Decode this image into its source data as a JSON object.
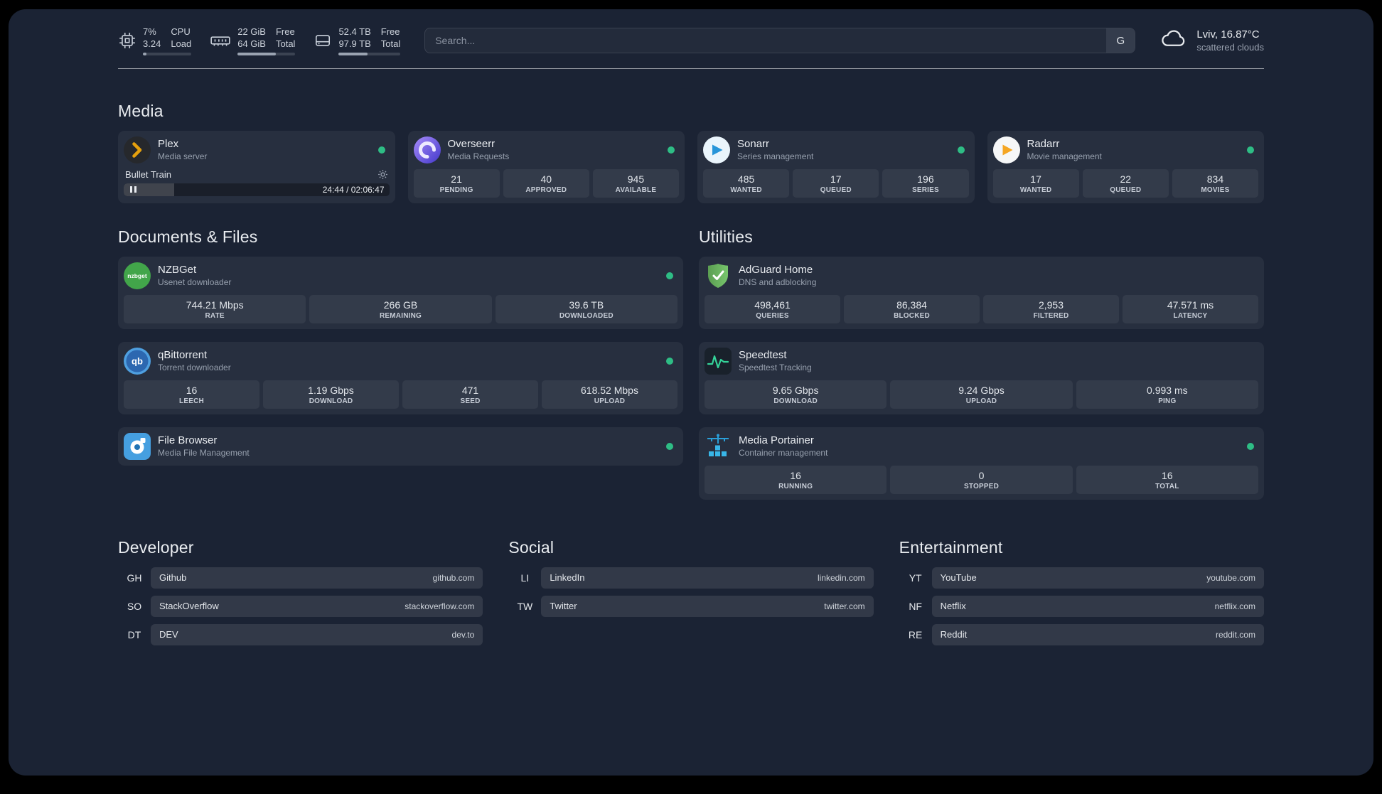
{
  "colors": {
    "panel_bg": "#1b2334",
    "status_online": "#2ebd85",
    "plex_accent": "#e5a00d",
    "progress_fill": "#9aa3b1"
  },
  "topbar": {
    "cpu": {
      "value": "7%",
      "sub": "3.24",
      "label": "CPU",
      "sublabel": "Load",
      "bar": "width:7%"
    },
    "memory": {
      "value": "22 GiB",
      "sub": "64 GiB",
      "label": "Free",
      "sublabel": "Total",
      "bar": "width:66%"
    },
    "disk": {
      "value": "52.4 TB",
      "sub": "97.9 TB",
      "label": "Free",
      "sublabel": "Total",
      "bar": "width:47%"
    },
    "search": {
      "placeholder": "Search...",
      "provider": "G"
    },
    "weather": {
      "location": "Lviv, 16.87°C",
      "condition": "scattered clouds"
    }
  },
  "media": {
    "title": "Media",
    "plex": {
      "name": "Plex",
      "desc": "Media server",
      "np_title": "Bullet Train",
      "np_time": "24:44 / 02:06:47",
      "np_bar": "width:19%"
    },
    "overseerr": {
      "name": "Overseerr",
      "desc": "Media Requests",
      "stats": [
        {
          "v": "21",
          "l": "PENDING"
        },
        {
          "v": "40",
          "l": "APPROVED"
        },
        {
          "v": "945",
          "l": "AVAILABLE"
        }
      ]
    },
    "sonarr": {
      "name": "Sonarr",
      "desc": "Series management",
      "stats": [
        {
          "v": "485",
          "l": "WANTED"
        },
        {
          "v": "17",
          "l": "QUEUED"
        },
        {
          "v": "196",
          "l": "SERIES"
        }
      ]
    },
    "radarr": {
      "name": "Radarr",
      "desc": "Movie management",
      "stats": [
        {
          "v": "17",
          "l": "WANTED"
        },
        {
          "v": "22",
          "l": "QUEUED"
        },
        {
          "v": "834",
          "l": "MOVIES"
        }
      ]
    }
  },
  "documents": {
    "title": "Documents & Files",
    "nzbget": {
      "name": "NZBGet",
      "desc": "Usenet downloader",
      "stats": [
        {
          "v": "744.21 Mbps",
          "l": "RATE"
        },
        {
          "v": "266 GB",
          "l": "REMAINING"
        },
        {
          "v": "39.6 TB",
          "l": "DOWNLOADED"
        }
      ]
    },
    "qbittorrent": {
      "name": "qBittorrent",
      "desc": "Torrent downloader",
      "stats": [
        {
          "v": "16",
          "l": "LEECH"
        },
        {
          "v": "1.19 Gbps",
          "l": "DOWNLOAD"
        },
        {
          "v": "471",
          "l": "SEED"
        },
        {
          "v": "618.52 Mbps",
          "l": "UPLOAD"
        }
      ]
    },
    "filebrowser": {
      "name": "File Browser",
      "desc": "Media File Management"
    }
  },
  "utilities": {
    "title": "Utilities",
    "adguard": {
      "name": "AdGuard Home",
      "desc": "DNS and adblocking",
      "stats": [
        {
          "v": "498,461",
          "l": "QUERIES"
        },
        {
          "v": "86,384",
          "l": "BLOCKED"
        },
        {
          "v": "2,953",
          "l": "FILTERED"
        },
        {
          "v": "47.571 ms",
          "l": "LATENCY"
        }
      ]
    },
    "speedtest": {
      "name": "Speedtest",
      "desc": "Speedtest Tracking",
      "stats": [
        {
          "v": "9.65 Gbps",
          "l": "DOWNLOAD"
        },
        {
          "v": "9.24 Gbps",
          "l": "UPLOAD"
        },
        {
          "v": "0.993 ms",
          "l": "PING"
        }
      ]
    },
    "portainer": {
      "name": "Media Portainer",
      "desc": "Container management",
      "stats": [
        {
          "v": "16",
          "l": "RUNNING"
        },
        {
          "v": "0",
          "l": "STOPPED"
        },
        {
          "v": "16",
          "l": "TOTAL"
        }
      ]
    }
  },
  "bookmarks": {
    "developer": {
      "title": "Developer",
      "links": [
        {
          "abbr": "GH",
          "name": "Github",
          "url": "github.com"
        },
        {
          "abbr": "SO",
          "name": "StackOverflow",
          "url": "stackoverflow.com"
        },
        {
          "abbr": "DT",
          "name": "DEV",
          "url": "dev.to"
        }
      ]
    },
    "social": {
      "title": "Social",
      "links": [
        {
          "abbr": "LI",
          "name": "LinkedIn",
          "url": "linkedin.com"
        },
        {
          "abbr": "TW",
          "name": "Twitter",
          "url": "twitter.com"
        }
      ]
    },
    "entertainment": {
      "title": "Entertainment",
      "links": [
        {
          "abbr": "YT",
          "name": "YouTube",
          "url": "youtube.com"
        },
        {
          "abbr": "NF",
          "name": "Netflix",
          "url": "netflix.com"
        },
        {
          "abbr": "RE",
          "name": "Reddit",
          "url": "reddit.com"
        }
      ]
    }
  }
}
